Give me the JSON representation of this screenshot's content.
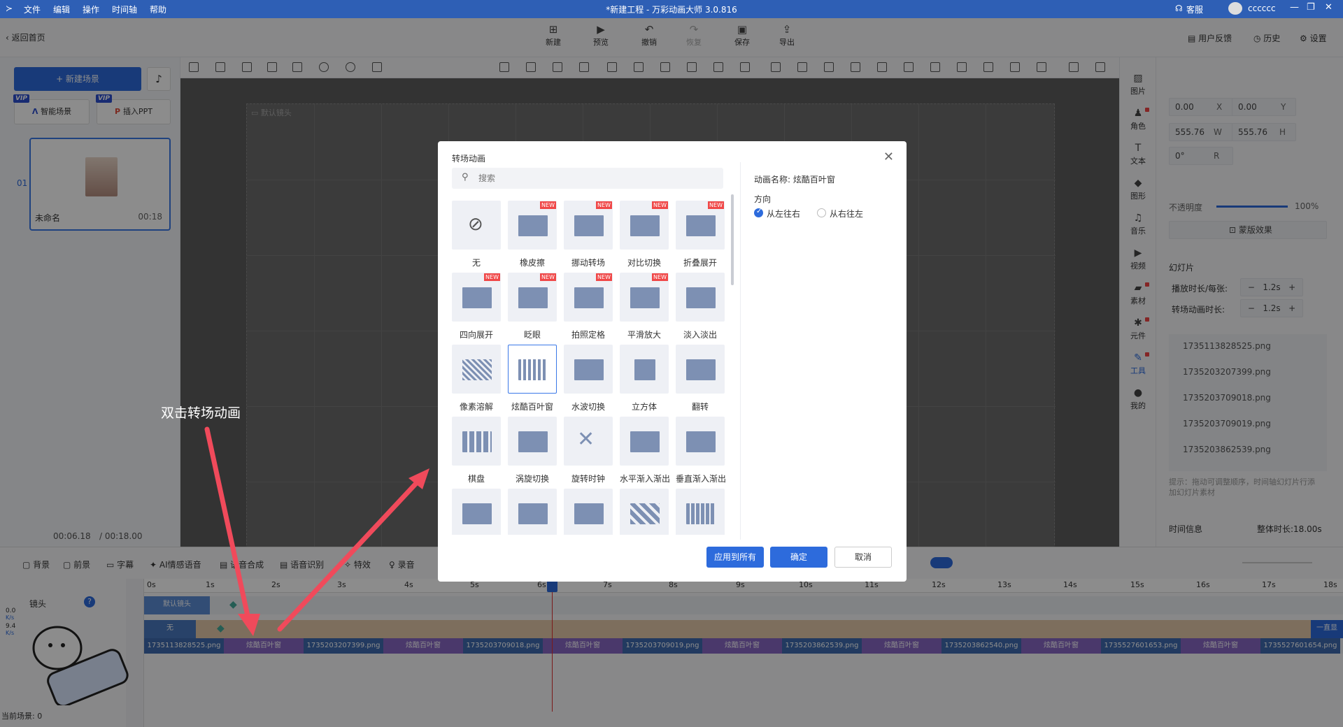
{
  "titlebar": {
    "menu": [
      "文件",
      "编辑",
      "操作",
      "时间轴",
      "帮助"
    ],
    "title": "*新建工程 - 万彩动画大师 3.0.816",
    "service": "客服",
    "user": "cccccc"
  },
  "toolbar": {
    "back": "返回首页",
    "buttons": [
      "新建",
      "预览",
      "撤销",
      "恢复",
      "保存",
      "导出"
    ],
    "right": [
      "用户反馈",
      "历史",
      "设置"
    ]
  },
  "left": {
    "new_scene": "+ 新建场景",
    "vip": "VIP",
    "smart_scene": "智能场景",
    "insert_ppt": "插入PPT",
    "scene_index": "01",
    "scene_name": "未命名",
    "scene_duration": "00:18"
  },
  "canvas": {
    "lens_label": "默认镜头"
  },
  "time": {
    "current": "00:06.18",
    "total": "/ 00:18.00"
  },
  "vbar": [
    "图片",
    "角色",
    "文本",
    "图形",
    "音乐",
    "视频",
    "素材",
    "元件",
    "工具",
    "我的"
  ],
  "rpanel": {
    "x": "0.00",
    "x_lbl": "X",
    "y": "0.00",
    "y_lbl": "Y",
    "w": "555.76",
    "w_lbl": "W",
    "h": "555.76",
    "h_lbl": "H",
    "r": "0°",
    "r_lbl": "R",
    "opacity_lbl": "不透明度",
    "opacity_val": "100%",
    "opacity": 1.0,
    "mask": "蒙版效果",
    "slides_title": "幻灯片",
    "play_dur_lbl": "播放时长/每张:",
    "play_dur": "1.2s",
    "trans_dur_lbl": "转场动画时长:",
    "trans_dur": "1.2s",
    "files": [
      "1735113828525.png",
      "1735203207399.png",
      "1735203709018.png",
      "1735203709019.png",
      "1735203862539.png"
    ],
    "tip": "提示：拖动可调整顺序，时间轴幻灯片行添加幻灯片素材",
    "time_info": "时间信息",
    "total_dur": "整体时长:18.00s"
  },
  "timeline": {
    "tools": [
      "背景",
      "前景",
      "字幕",
      "AI情感语音",
      "语音合成",
      "语音识别",
      "特效",
      "录音"
    ],
    "ruler": [
      "0s",
      "1s",
      "2s",
      "3s",
      "4s",
      "5s",
      "6s",
      "7s",
      "8s",
      "9s",
      "10s",
      "11s",
      "12s",
      "13s",
      "14s",
      "15s",
      "16s",
      "17s",
      "18s"
    ],
    "lens_track": "镜头",
    "lens_seg": "默认镜头",
    "none_seg": "无",
    "always_show": "一直显",
    "speeds": [
      "0.0",
      "K/s",
      "9.4",
      "K/s"
    ],
    "current_scene": "当前场景: 0",
    "slide_segs": [
      "1735113828525.png",
      "炫酷百叶窗",
      "1735203207399.png",
      "炫酷百叶窗",
      "1735203709018.png",
      "炫酷百叶窗",
      "1735203709019.png",
      "炫酷百叶窗",
      "1735203862539.png",
      "炫酷百叶窗",
      "1735203862540.png",
      "炫酷百叶窗",
      "1735527601653.png",
      "炫酷百叶窗",
      "1735527601654.png"
    ]
  },
  "dialog": {
    "title": "转场动画",
    "search_placeholder": "搜索",
    "anim_name": "动画名称: 炫酷百叶窗",
    "direction": "方向",
    "dir_ltr": "从左往右",
    "dir_rtl": "从右往左",
    "apply_all": "应用到所有",
    "ok": "确定",
    "cancel": "取消",
    "new_tag": "NEW",
    "animations": [
      {
        "label": "无",
        "new": false
      },
      {
        "label": "橡皮擦",
        "new": true
      },
      {
        "label": "挪动转场",
        "new": true
      },
      {
        "label": "对比切换",
        "new": true
      },
      {
        "label": "折叠展开",
        "new": true
      },
      {
        "label": "四向展开",
        "new": true
      },
      {
        "label": "眨眼",
        "new": true
      },
      {
        "label": "拍照定格",
        "new": true
      },
      {
        "label": "平滑放大",
        "new": true
      },
      {
        "label": "淡入淡出",
        "new": false
      },
      {
        "label": "像素溶解",
        "new": false
      },
      {
        "label": "炫酷百叶窗",
        "new": false
      },
      {
        "label": "水波切换",
        "new": false
      },
      {
        "label": "立方体",
        "new": false
      },
      {
        "label": "翻转",
        "new": false
      },
      {
        "label": "棋盘",
        "new": false
      },
      {
        "label": "涡旋切换",
        "new": false
      },
      {
        "label": "旋转时钟",
        "new": false
      },
      {
        "label": "水平渐入渐出",
        "new": false
      },
      {
        "label": "垂直渐入渐出",
        "new": false
      },
      {
        "label": "",
        "new": false
      },
      {
        "label": "",
        "new": false
      },
      {
        "label": "",
        "new": false
      },
      {
        "label": "",
        "new": false
      },
      {
        "label": "",
        "new": false
      }
    ]
  },
  "annotation": "双击转场动画"
}
